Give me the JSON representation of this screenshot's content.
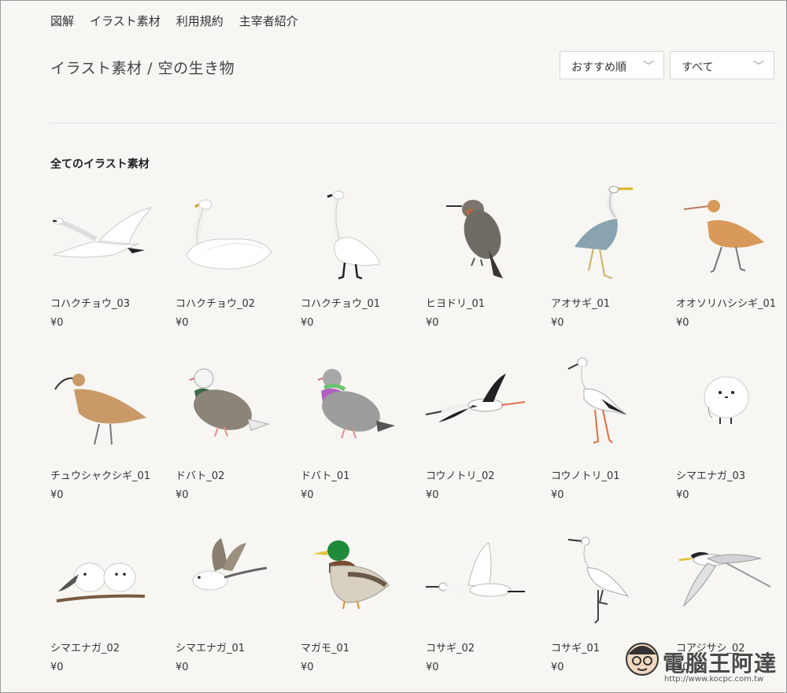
{
  "nav": [
    "図解",
    "イラスト素材",
    "利用規約",
    "主宰者紹介"
  ],
  "page_title": "イラスト素材 / 空の生き物",
  "sort_select": {
    "value": "おすすめ順"
  },
  "filter_select": {
    "value": "すべて"
  },
  "section_title": "全てのイラスト素材",
  "items": [
    {
      "name": "コハクチョウ_03",
      "price": "¥0",
      "icon": "swan-flying"
    },
    {
      "name": "コハクチョウ_02",
      "price": "¥0",
      "icon": "swan-swimming"
    },
    {
      "name": "コハクチョウ_01",
      "price": "¥0",
      "icon": "swan-standing"
    },
    {
      "name": "ヒヨドリ_01",
      "price": "¥0",
      "icon": "bulbul"
    },
    {
      "name": "アオサギ_01",
      "price": "¥0",
      "icon": "grey-heron"
    },
    {
      "name": "オオソリハシシギ_01",
      "price": "¥0",
      "icon": "godwit"
    },
    {
      "name": "チュウシャクシギ_01",
      "price": "¥0",
      "icon": "whimbrel"
    },
    {
      "name": "ドバト_02",
      "price": "¥0",
      "icon": "pigeon"
    },
    {
      "name": "ドバト_01",
      "price": "¥0",
      "icon": "pigeon"
    },
    {
      "name": "コウノトリ_02",
      "price": "¥0",
      "icon": "stork-flying"
    },
    {
      "name": "コウノトリ_01",
      "price": "¥0",
      "icon": "stork-standing"
    },
    {
      "name": "シマエナガ_03",
      "price": "¥0",
      "icon": "long-tailed-tit"
    },
    {
      "name": "シマエナガ_02",
      "price": "¥0",
      "icon": "long-tailed-tits-pair"
    },
    {
      "name": "シマエナガ_01",
      "price": "¥0",
      "icon": "long-tailed-tit-flying"
    },
    {
      "name": "マガモ_01",
      "price": "¥0",
      "icon": "mallard"
    },
    {
      "name": "コサギ_02",
      "price": "¥0",
      "icon": "egret-flying"
    },
    {
      "name": "コサギ_01",
      "price": "¥0",
      "icon": "egret-standing"
    },
    {
      "name": "コアジサシ_02",
      "price": "¥0",
      "icon": "tern"
    }
  ],
  "watermark": {
    "text": "電腦王阿達",
    "url": "http://www.kocpc.com.tw"
  },
  "colors": {
    "background": "#f7f6f2",
    "text": "#333333",
    "divider": "#e2e2e2"
  }
}
